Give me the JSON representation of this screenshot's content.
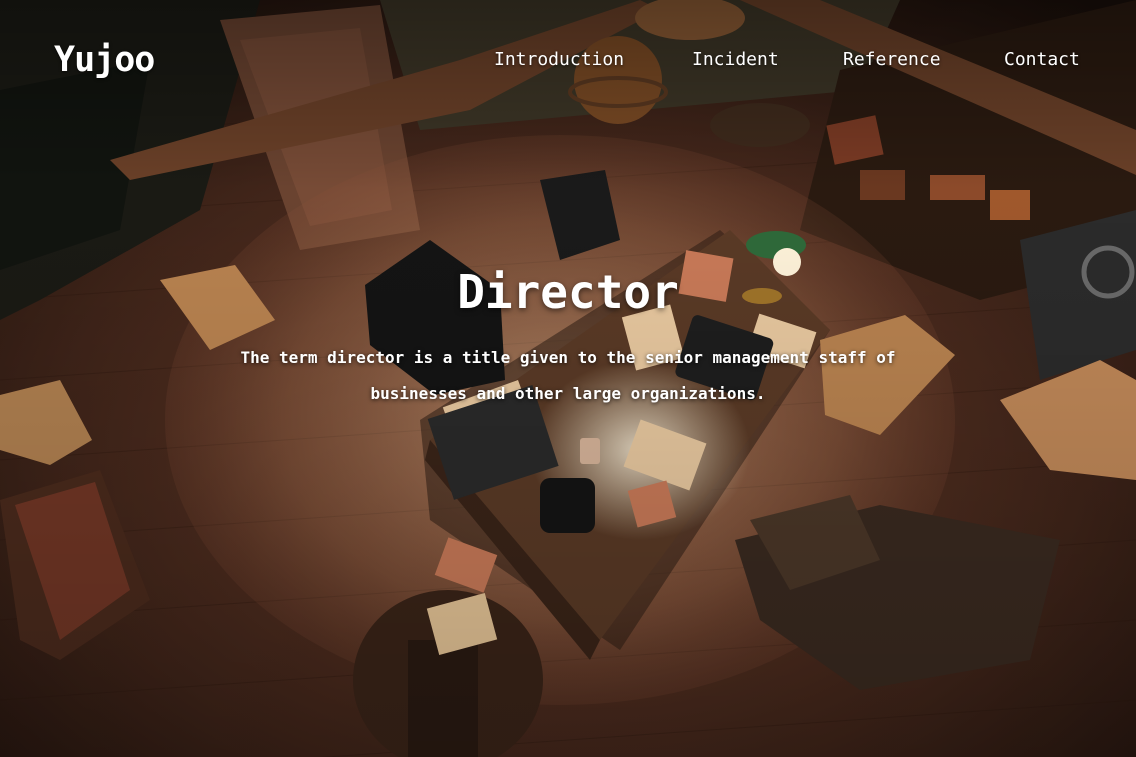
{
  "brand": {
    "name": "Yujoo"
  },
  "nav": {
    "items": [
      {
        "label": "Introduction"
      },
      {
        "label": "Incident"
      },
      {
        "label": "Reference"
      },
      {
        "label": "Contact"
      }
    ]
  },
  "hero": {
    "title": "Director",
    "description": "The term director is a title given to the senior management staff of businesses and other large organizations."
  },
  "colors": {
    "background": "#1e120c",
    "floor": "#5a3424",
    "spotlight": "#f5d2a8",
    "text": "#ffffff"
  }
}
